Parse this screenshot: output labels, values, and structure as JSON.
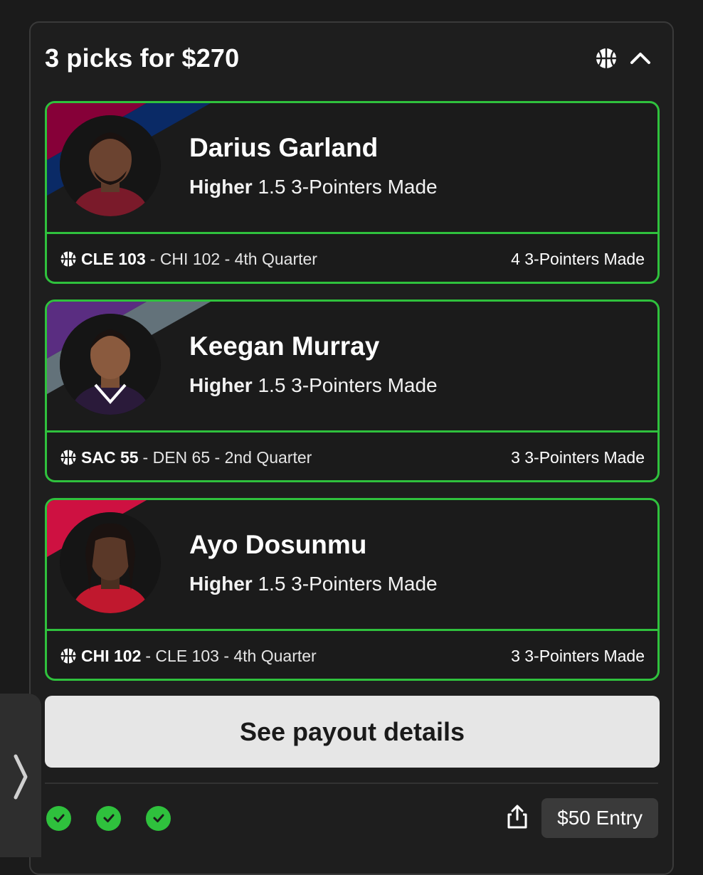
{
  "header": {
    "title": "3 picks for $270",
    "icons": [
      "basketball-icon",
      "chevron-up-icon"
    ]
  },
  "picks": [
    {
      "player": "Darius Garland",
      "direction": "Higher",
      "line": "1.5 3-Pointers Made",
      "team": "CLE 103",
      "game_rest": "- CHI 102 - 4th Quarter",
      "result": "4 3-Pointers Made",
      "stripe_colors": [
        "#860038",
        "#041e42"
      ]
    },
    {
      "player": "Keegan Murray",
      "direction": "Higher",
      "line": "1.5 3-Pointers Made",
      "team": "SAC 55",
      "game_rest": "- DEN 65 - 2nd Quarter",
      "result": "3 3-Pointers Made",
      "stripe_colors": [
        "#5a2d81",
        "#63727a"
      ]
    },
    {
      "player": "Ayo Dosunmu",
      "direction": "Higher",
      "line": "1.5 3-Pointers Made",
      "team": "CHI 102",
      "game_rest": "- CLE 103 - 4th Quarter",
      "result": "3 3-Pointers Made",
      "stripe_colors": [
        "#ce1141",
        "#1b1b1b"
      ]
    }
  ],
  "payout_button": "See payout details",
  "footer": {
    "checks": 3,
    "entry": "$50 Entry"
  },
  "colors": {
    "accent_green": "#2fc13d",
    "card_bg": "#1e1e1e",
    "button_bg": "#e6e6e6"
  }
}
